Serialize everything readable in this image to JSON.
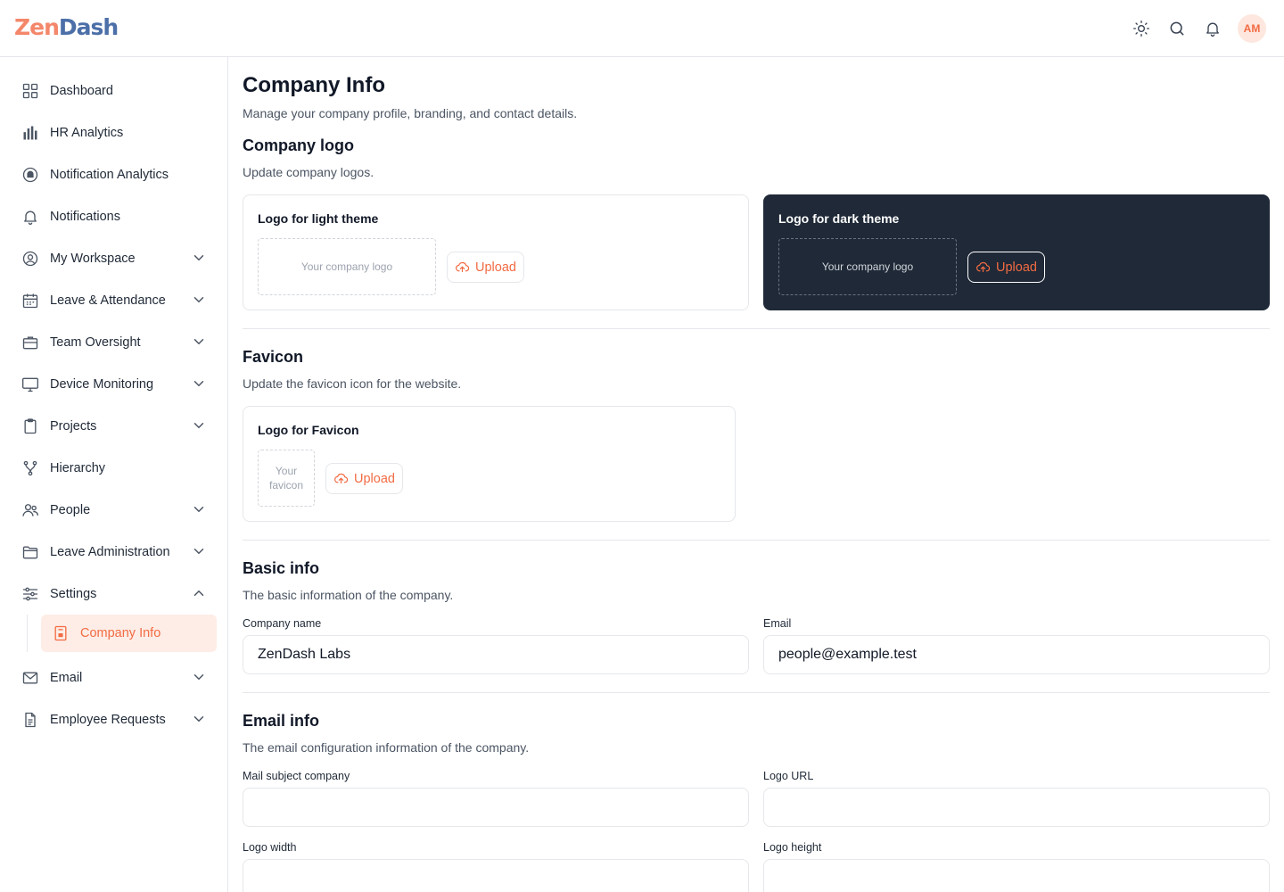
{
  "brand": {
    "part1": "Zen",
    "part2": "Dash"
  },
  "header": {
    "actions": [
      "theme-toggle",
      "search",
      "notifications"
    ],
    "avatar_initials": "AM"
  },
  "sidebar": {
    "items": [
      {
        "label": "Dashboard",
        "icon": "grid-icon"
      },
      {
        "label": "HR Analytics",
        "icon": "bar-chart-icon"
      },
      {
        "label": "Notification Analytics",
        "icon": "bell-circle-icon"
      },
      {
        "label": "Notifications",
        "icon": "bell-icon"
      },
      {
        "label": "My Workspace",
        "icon": "user-circle-icon",
        "expandable": true
      },
      {
        "label": "Leave & Attendance",
        "icon": "calendar-icon",
        "expandable": true
      },
      {
        "label": "Team Oversight",
        "icon": "briefcase-icon",
        "expandable": true
      },
      {
        "label": "Device Monitoring",
        "icon": "monitor-icon",
        "expandable": true
      },
      {
        "label": "Projects",
        "icon": "clipboard-icon",
        "expandable": true
      },
      {
        "label": "Hierarchy",
        "icon": "hierarchy-icon"
      },
      {
        "label": "People",
        "icon": "people-icon",
        "expandable": true
      },
      {
        "label": "Leave Administration",
        "icon": "folder-icon",
        "expandable": true
      },
      {
        "label": "Settings",
        "icon": "sliders-icon",
        "expandable": true,
        "expanded": true
      },
      {
        "label": "Email",
        "icon": "mail-icon",
        "expandable": true
      },
      {
        "label": "Employee Requests",
        "icon": "document-icon",
        "expandable": true
      }
    ],
    "active_sub": {
      "label": "Company Info",
      "icon": "company-icon"
    }
  },
  "page": {
    "title": "Company Info",
    "subtitle": "Manage your company profile, branding, and contact details."
  },
  "logo_section": {
    "title": "Company logo",
    "subtitle": "Update company logos.",
    "light_card": {
      "title": "Logo for light theme",
      "placeholder": "Your company logo",
      "button": "Upload"
    },
    "dark_card": {
      "title": "Logo for dark theme",
      "placeholder": "Your company logo",
      "button": "Upload"
    }
  },
  "favicon_section": {
    "title": "Favicon",
    "subtitle": "Update the favicon icon for the website.",
    "card": {
      "title": "Logo for Favicon",
      "placeholder_line1": "Your",
      "placeholder_line2": "favicon",
      "button": "Upload"
    }
  },
  "basic_info": {
    "title": "Basic info",
    "subtitle": "The basic information of the company.",
    "company_name_label": "Company name",
    "company_name_value": "ZenDash Labs",
    "email_label": "Email",
    "email_value": "people@example.test"
  },
  "email_info": {
    "title": "Email info",
    "subtitle": "The email configuration information of the company.",
    "mail_subject_label": "Mail subject company",
    "mail_subject_value": "",
    "logo_url_label": "Logo URL",
    "logo_url_value": "",
    "logo_width_label": "Logo width",
    "logo_width_value": "",
    "logo_height_label": "Logo height",
    "logo_height_value": ""
  },
  "colors": {
    "accent": "#f26b43",
    "dark_card": "#1f2937",
    "border": "#e5e7eb"
  }
}
